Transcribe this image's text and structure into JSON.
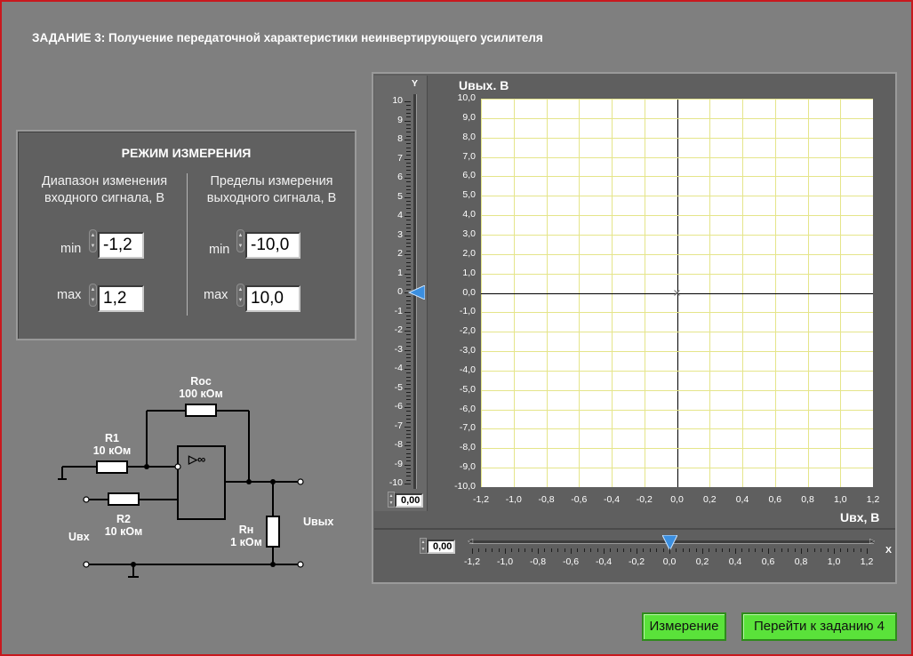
{
  "task_title": "ЗАДАНИЕ 3: Получение передаточной  характеристики неинвертирующего усилителя",
  "mode": {
    "title": "РЕЖИМ ИЗМЕРЕНИЯ",
    "input_range_title_line1": "Диапазон изменения",
    "input_range_title_line2": "входного сигнала, В",
    "output_limits_title_line1": "Пределы измерения",
    "output_limits_title_line2": "выходного сигнала, В",
    "min_label": "min",
    "max_label": "max",
    "input_min": "-1,2",
    "input_max": "1,2",
    "output_min": "-10,0",
    "output_max": "10,0"
  },
  "circuit": {
    "roc_label": "Roc",
    "roc_value": "100 кОм",
    "r1_label": "R1",
    "r1_value": "10 кОм",
    "r2_label": "R2",
    "r2_value": "10 кОм",
    "rn_label": "Rн",
    "rn_value": "1 кОм",
    "uin_label": "Uвх",
    "uout_label": "Uвых",
    "opamp_symbol": "▷∞"
  },
  "y_slider": {
    "label": "Y",
    "ticks": [
      "10",
      "9",
      "8",
      "7",
      "6",
      "5",
      "4",
      "3",
      "2",
      "1",
      "0",
      "-1",
      "-2",
      "-3",
      "-4",
      "-5",
      "-6",
      "-7",
      "-8",
      "-9",
      "-10"
    ],
    "value_display": "0,00",
    "value": 0,
    "marker_color": "#3b8fe0"
  },
  "x_slider": {
    "label": "X",
    "ticks": [
      "-1,2",
      "-1,0",
      "-0,8",
      "-0,6",
      "-0,4",
      "-0,2",
      "0,0",
      "0,2",
      "0,4",
      "0,6",
      "0,8",
      "1,0",
      "1,2"
    ],
    "value_display": "0,00",
    "value": 0,
    "marker_color": "#3b8fe0"
  },
  "graph": {
    "y_title": "Uвых. В",
    "x_title": "Uвх, В",
    "y_ticks": [
      "10,0",
      "9,0",
      "8,0",
      "7,0",
      "6,0",
      "5,0",
      "4,0",
      "3,0",
      "2,0",
      "1,0",
      "0,0",
      "-1,0",
      "-2,0",
      "-3,0",
      "-4,0",
      "-5,0",
      "-6,0",
      "-7,0",
      "-8,0",
      "-9,0",
      "-10,0"
    ],
    "x_ticks": [
      "-1,2",
      "-1,0",
      "-0,8",
      "-0,6",
      "-0,4",
      "-0,2",
      "0,0",
      "0,2",
      "0,4",
      "0,6",
      "0,8",
      "1,0",
      "1,2"
    ],
    "grid_color": "#e5e58a"
  },
  "buttons": {
    "measure": "Измерение",
    "next_task": "Перейти к заданию 4"
  },
  "colors": {
    "background": "#7f7f7f",
    "frame": "#c8191e",
    "button_green": "#5ae23a",
    "panel": "#606060"
  }
}
